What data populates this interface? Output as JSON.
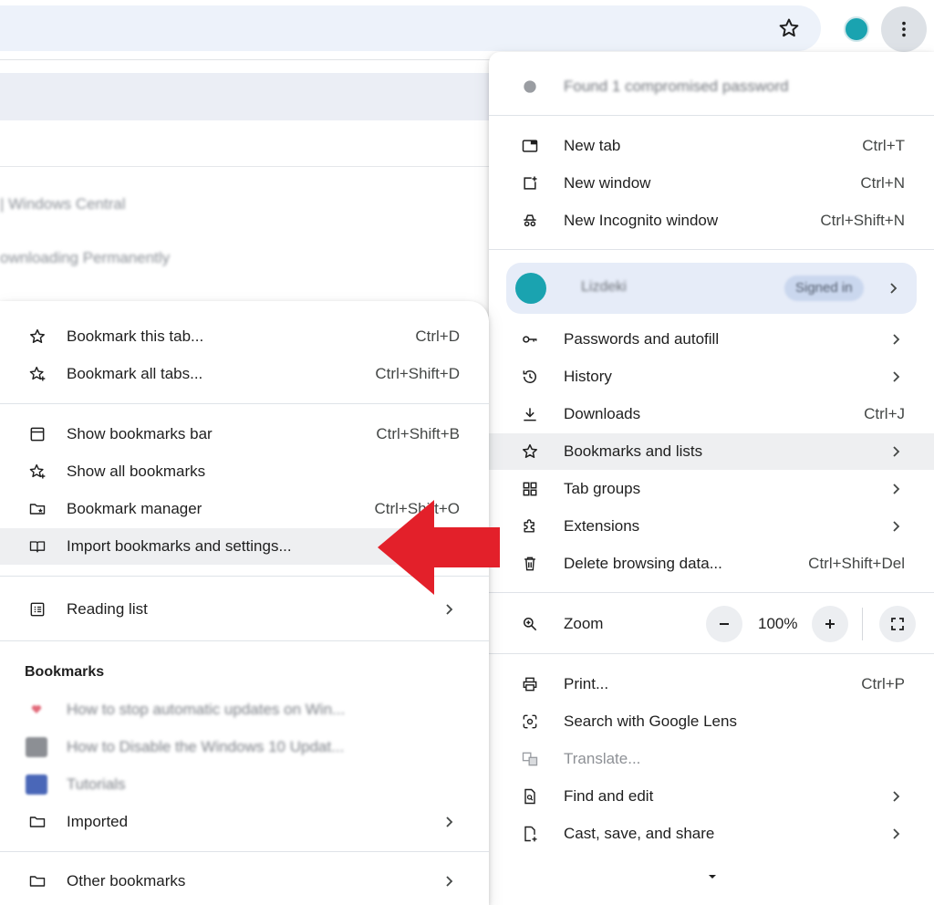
{
  "browser": {
    "background_items": [
      {
        "label": "| Windows Central"
      },
      {
        "label": "ownloading Permanently"
      }
    ]
  },
  "main_menu": {
    "password_notice": "Found 1 compromised password",
    "new_tab": {
      "label": "New tab",
      "shortcut": "Ctrl+T",
      "icon": "new-tab-icon"
    },
    "new_window": {
      "label": "New window",
      "shortcut": "Ctrl+N",
      "icon": "new-window-icon"
    },
    "incognito": {
      "label": "New Incognito window",
      "shortcut": "Ctrl+Shift+N",
      "icon": "incognito-icon"
    },
    "profile": {
      "name": "Lizdeki",
      "status": "Signed in"
    },
    "passwords": {
      "label": "Passwords and autofill",
      "icon": "key-icon"
    },
    "history": {
      "label": "History",
      "icon": "history-icon"
    },
    "downloads": {
      "label": "Downloads",
      "shortcut": "Ctrl+J",
      "icon": "download-icon"
    },
    "bookmarks": {
      "label": "Bookmarks and lists",
      "icon": "star-icon"
    },
    "tab_groups": {
      "label": "Tab groups",
      "icon": "tab-groups-icon"
    },
    "extensions": {
      "label": "Extensions",
      "icon": "puzzle-icon"
    },
    "delete_data": {
      "label": "Delete browsing data...",
      "shortcut": "Ctrl+Shift+Del",
      "icon": "trash-icon"
    },
    "zoom": {
      "label": "Zoom",
      "value": "100%",
      "icon": "zoom-icon"
    },
    "print": {
      "label": "Print...",
      "shortcut": "Ctrl+P",
      "icon": "print-icon"
    },
    "lens": {
      "label": "Search with Google Lens",
      "icon": "lens-icon"
    },
    "translate": {
      "label": "Translate...",
      "icon": "translate-icon",
      "disabled": true
    },
    "find_edit": {
      "label": "Find and edit",
      "icon": "find-page-icon"
    },
    "cast": {
      "label": "Cast, save, and share",
      "icon": "cast-save-icon"
    }
  },
  "bookmarks_menu": {
    "bookmark_tab": {
      "label": "Bookmark this tab...",
      "shortcut": "Ctrl+D",
      "icon": "star-icon"
    },
    "bookmark_all": {
      "label": "Bookmark all tabs...",
      "shortcut": "Ctrl+Shift+D",
      "icon": "star-plus-icon"
    },
    "show_bar": {
      "label": "Show bookmarks bar",
      "shortcut": "Ctrl+Shift+B",
      "icon": "bookmarks-bar-icon"
    },
    "show_all": {
      "label": "Show all bookmarks",
      "icon": "star-plus-icon"
    },
    "manager": {
      "label": "Bookmark manager",
      "shortcut": "Ctrl+Shift+O",
      "icon": "bookmark-manager-icon"
    },
    "import": {
      "label": "Import bookmarks and settings...",
      "icon": "import-book-icon"
    },
    "reading_list": {
      "label": "Reading list",
      "icon": "reading-list-icon"
    },
    "section_title": "Bookmarks",
    "items": [
      {
        "label": "How to stop automatic updates on Win..."
      },
      {
        "label": "How to Disable the Windows 10 Updat..."
      },
      {
        "label": "Tutorials"
      }
    ],
    "imported": {
      "label": "Imported",
      "icon": "folder-icon"
    },
    "other": {
      "label": "Other bookmarks",
      "icon": "folder-icon"
    }
  },
  "colors": {
    "accent": "#1aa3b0",
    "arrow": "#e3202a",
    "highlight": "#eeeff1",
    "omnibox": "#edf2fa"
  }
}
